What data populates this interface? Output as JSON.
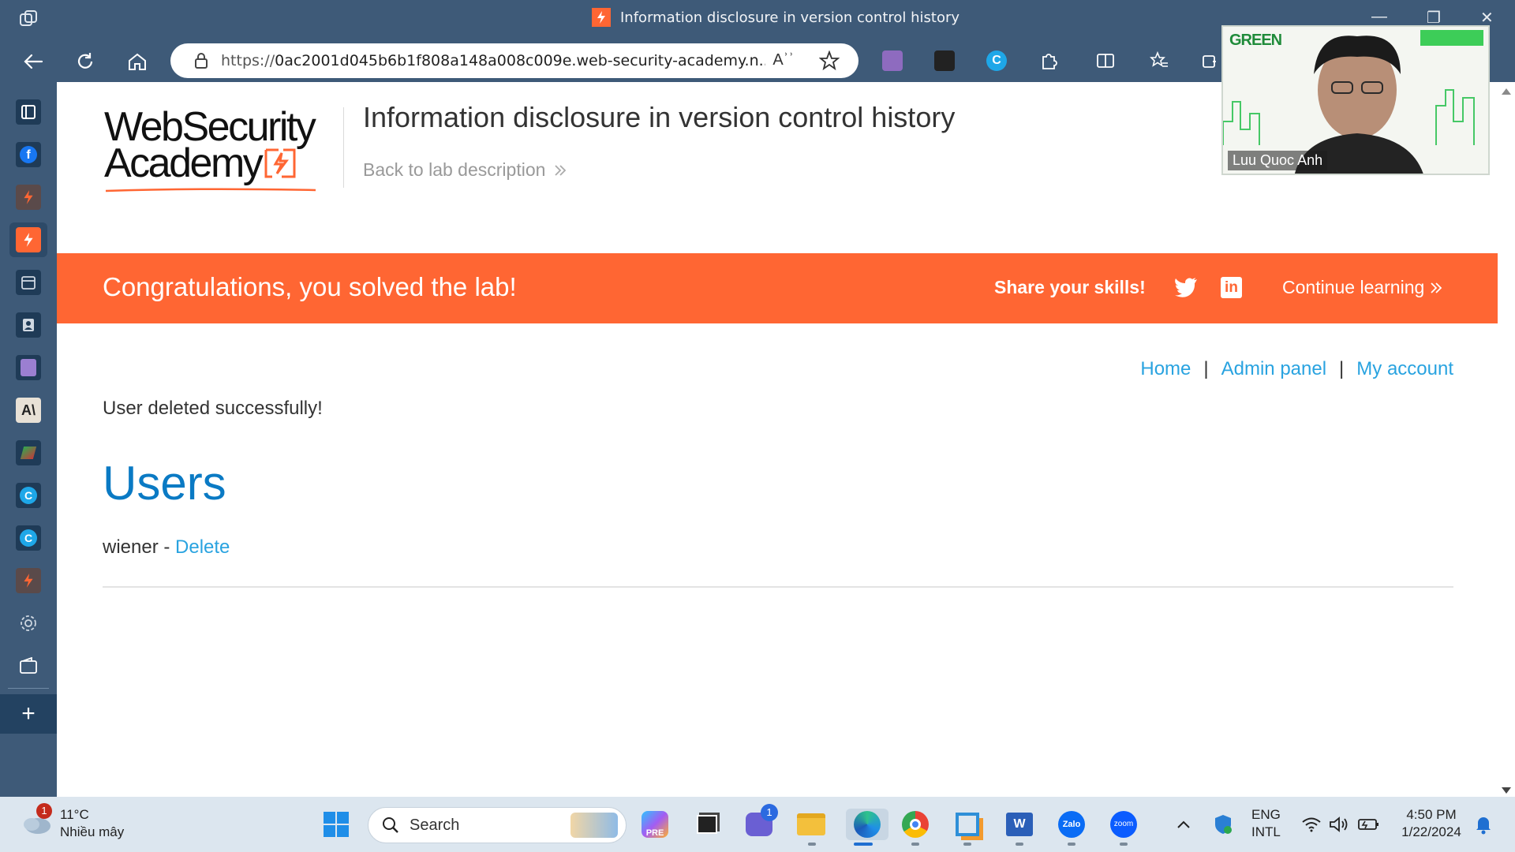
{
  "browser": {
    "tab_title": "Information disclosure in version control history",
    "url_scheme": "https://",
    "url_rest": "0ac2001d045b6b1f808a148a008c009e.web-security-academy.n...",
    "read_aloud_glyph": "Aʾʾ"
  },
  "page": {
    "logo_line1": "WebSecurity",
    "logo_line2": "Academy",
    "lab_title": "Information disclosure in version control history",
    "back_link": "Back to lab description",
    "banner": {
      "congrats": "Congratulations, you solved the lab!",
      "share": "Share your skills!",
      "linkedin_glyph": "in",
      "continue": "Continue learning"
    },
    "nav": {
      "home": "Home",
      "admin_panel": "Admin panel",
      "my_account": "My account",
      "separator": "|"
    },
    "message": "User deleted successfully!",
    "users_heading": "Users",
    "user_row": {
      "name": "wiener",
      "dash": " - ",
      "delete": "Delete"
    }
  },
  "video_overlay": {
    "participant": "Luu Quoc Anh",
    "brand": "GREEN"
  },
  "taskbar": {
    "weather_temp": "11°C",
    "weather_desc": "Nhiều mây",
    "weather_badge": "1",
    "search_label": "Search",
    "teams_badge": "1",
    "lang_line1": "ENG",
    "lang_line2": "INTL",
    "time": "4:50 PM",
    "date": "1/22/2024",
    "zalo_label": "Zalo",
    "zoom_label": "zoom",
    "copilot_label": "PRE"
  },
  "colors": {
    "accent_orange": "#ff6633",
    "link_blue": "#29a3e0",
    "heading_blue": "#0a7ac4",
    "chrome_bg": "#3e5a78"
  }
}
